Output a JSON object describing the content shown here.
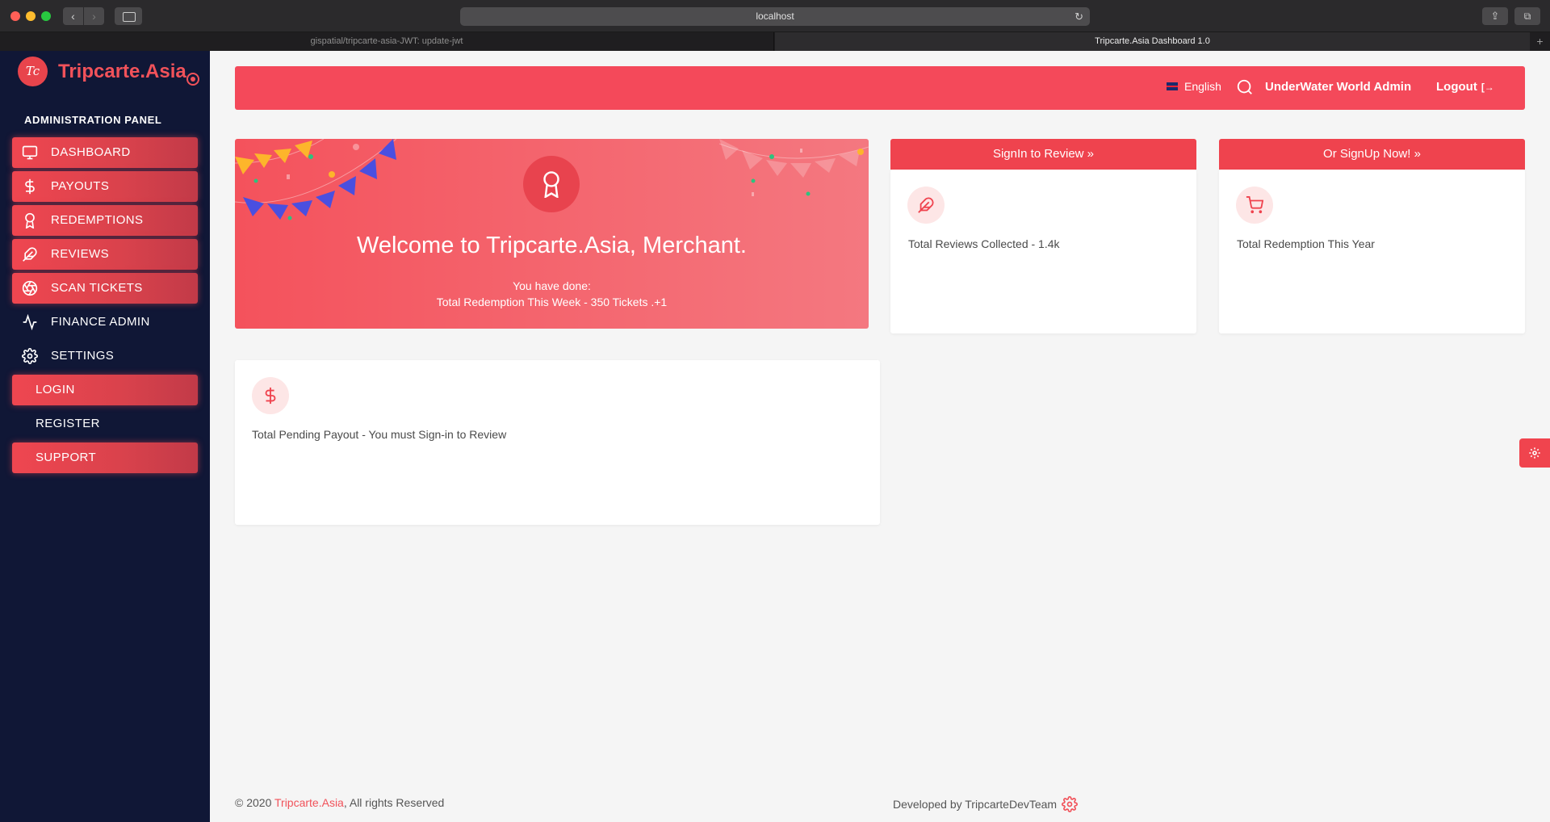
{
  "browser": {
    "url": "localhost",
    "tabs": [
      {
        "label": "gispatial/tripcarte-asia-JWT: update-jwt"
      },
      {
        "label": "Tripcarte.Asia Dashboard 1.0"
      }
    ],
    "new_tab_label": "+"
  },
  "sidebar": {
    "brand": "Tripcarte.Asia",
    "logo_mark": "Tc",
    "panel_title": "ADMINISTRATION PANEL",
    "items": [
      {
        "label": "DASHBOARD",
        "icon": "monitor-icon",
        "active": true
      },
      {
        "label": "PAYOUTS",
        "icon": "dollar-icon",
        "active": true
      },
      {
        "label": "REDEMPTIONS",
        "icon": "award-icon",
        "active": true
      },
      {
        "label": "REVIEWS",
        "icon": "feather-icon",
        "active": true
      },
      {
        "label": "SCAN TICKETS",
        "icon": "aperture-icon",
        "active": true
      },
      {
        "label": "FINANCE ADMIN",
        "icon": "activity-icon",
        "active": false
      },
      {
        "label": "SETTINGS",
        "icon": "gear-icon",
        "active": false
      },
      {
        "label": "LOGIN",
        "icon": "",
        "active": true
      },
      {
        "label": "REGISTER",
        "icon": "",
        "active": false
      },
      {
        "label": "SUPPORT",
        "icon": "",
        "active": true
      }
    ]
  },
  "header": {
    "language": "English",
    "admin_name": "UnderWater World Admin",
    "logout_label": "Logout"
  },
  "welcome": {
    "title": "Welcome to Tripcarte.Asia, Merchant.",
    "subtitle": "You have done:",
    "stat": "Total Redemption This Week - 350 Tickets .+1"
  },
  "cards": {
    "review_button": "SignIn to Review  »",
    "signup_button": "Or SignUp Now!  »",
    "reviews_text": "Total Reviews Collected - 1.4k",
    "redemption_text": "Total Redemption This Year",
    "payout_text": "Total Pending Payout - You must Sign-in to Review"
  },
  "footer": {
    "copyright_prefix": "© 2020 ",
    "brand_link": "Tripcarte.Asia",
    "copyright_suffix": ", All rights Reserved",
    "developer": "Developed by TripcarteDevTeam"
  },
  "colors": {
    "accent": "#f4495a",
    "sidebar_bg": "#101736",
    "page_bg": "#f5f5f5"
  }
}
